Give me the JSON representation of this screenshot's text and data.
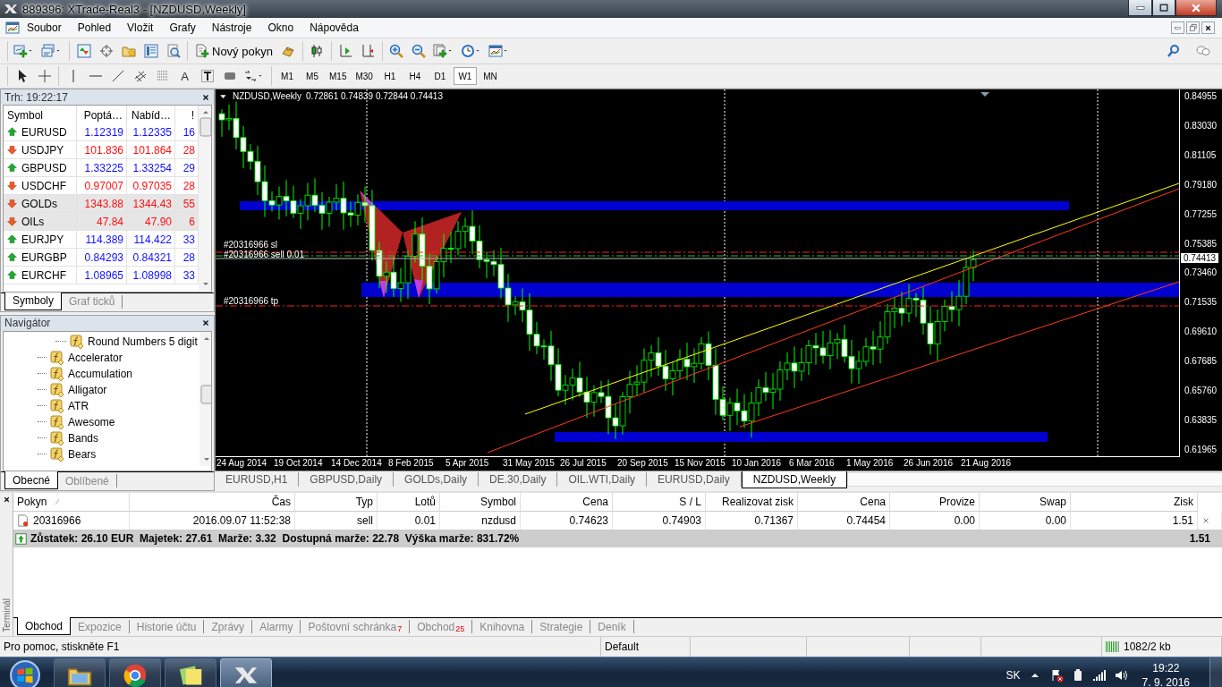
{
  "window": {
    "title": "889396: XTrade-Real3 - [NZDUSD,Weekly]"
  },
  "menu": [
    "Soubor",
    "Pohled",
    "Vložit",
    "Grafy",
    "Nástroje",
    "Okno",
    "Nápověda"
  ],
  "toolbar": {
    "new_order": "Nový pokyn",
    "text_tool": "A"
  },
  "timeframes": [
    {
      "label": "M1",
      "selected": false
    },
    {
      "label": "M5",
      "selected": false
    },
    {
      "label": "M15",
      "selected": false
    },
    {
      "label": "M30",
      "selected": false
    },
    {
      "label": "H1",
      "selected": false
    },
    {
      "label": "H4",
      "selected": false
    },
    {
      "label": "D1",
      "selected": false
    },
    {
      "label": "W1",
      "selected": true
    },
    {
      "label": "MN",
      "selected": false
    }
  ],
  "market_watch": {
    "title": "Trh: 19:22:17",
    "columns": [
      "Symbol",
      "Poptá…",
      "Nabíd…",
      "!"
    ],
    "rows": [
      {
        "symbol": "EURUSD",
        "bid": "1.12319",
        "ask": "1.12335",
        "spread": "16",
        "rising": true,
        "highlighted": false
      },
      {
        "symbol": "USDJPY",
        "bid": "101.836",
        "ask": "101.864",
        "spread": "28",
        "rising": false,
        "highlighted": false
      },
      {
        "symbol": "GBPUSD",
        "bid": "1.33225",
        "ask": "1.33254",
        "spread": "29",
        "rising": true,
        "highlighted": false
      },
      {
        "symbol": "USDCHF",
        "bid": "0.97007",
        "ask": "0.97035",
        "spread": "28",
        "rising": false,
        "highlighted": false
      },
      {
        "symbol": "GOLDs",
        "bid": "1343.88",
        "ask": "1344.43",
        "spread": "55",
        "rising": false,
        "highlighted": true
      },
      {
        "symbol": "OILs",
        "bid": "47.84",
        "ask": "47.90",
        "spread": "6",
        "rising": false,
        "highlighted": true
      },
      {
        "symbol": "EURJPY",
        "bid": "114.389",
        "ask": "114.422",
        "spread": "33",
        "rising": true,
        "highlighted": false
      },
      {
        "symbol": "EURGBP",
        "bid": "0.84293",
        "ask": "0.84321",
        "spread": "28",
        "rising": true,
        "highlighted": false
      },
      {
        "symbol": "EURCHF",
        "bid": "1.08965",
        "ask": "1.08998",
        "spread": "33",
        "rising": true,
        "highlighted": false
      }
    ],
    "tabs": [
      {
        "label": "Symboly",
        "selected": true
      },
      {
        "label": "Graf ticků",
        "selected": false
      }
    ]
  },
  "navigator": {
    "title": "Navigátor",
    "items": [
      {
        "children": [
          {
            "label": "Round Numbers 5 digit"
          }
        ]
      },
      {
        "label": "Accelerator"
      },
      {
        "label": "Accumulation"
      },
      {
        "label": "Alligator"
      },
      {
        "label": "ATR"
      },
      {
        "label": "Awesome"
      },
      {
        "label": "Bands"
      },
      {
        "label": "Bears"
      }
    ],
    "tabs": [
      {
        "label": "Obecné",
        "selected": true
      },
      {
        "label": "Oblíbené",
        "selected": false
      }
    ]
  },
  "chart": {
    "symbol": "NZDUSD,Weekly",
    "ohlc": "0.72861 0.74839 0.72844 0.74413",
    "price_ticks": [
      "0.84955",
      "0.83030",
      "0.81105",
      "0.79180",
      "0.77255",
      "0.75385",
      "0.73460",
      "0.71535",
      "0.69610",
      "0.67685",
      "0.65760",
      "0.63835",
      "0.61965"
    ],
    "current_price": "0.74413",
    "date_ticks": [
      "24 Aug 2014",
      "19 Oct 2014",
      "14 Dec 2014",
      "8 Feb 2015",
      "5 Apr 2015",
      "31 May 2015",
      "26 Jul 2015",
      "20 Sep 2015",
      "15 Nov 2015",
      "10 Jan 2016",
      "6 Mar 2016",
      "1 May 2016",
      "26 Jun 2016",
      "21 Aug 2016"
    ],
    "order_labels": [
      {
        "text": "#20316966 sl",
        "kind": "sl"
      },
      {
        "text": "#20316966 sell 0.01",
        "kind": "open"
      },
      {
        "text": "#20316966 tp",
        "kind": "tp"
      }
    ]
  },
  "chart_tabs": [
    {
      "label": "EURUSD,H1",
      "selected": false
    },
    {
      "label": "GBPUSD,Daily",
      "selected": false
    },
    {
      "label": "GOLDs,Daily",
      "selected": false
    },
    {
      "label": "DE.30,Daily",
      "selected": false
    },
    {
      "label": "OIL.WTI,Daily",
      "selected": false
    },
    {
      "label": "EURUSD,Daily",
      "selected": false
    },
    {
      "label": "NZDUSD,Weekly",
      "selected": true
    }
  ],
  "terminal": {
    "side_label": "Terminál",
    "columns": [
      "Pokyn",
      "Čas",
      "Typ",
      "Lotů",
      "Symbol",
      "Cena",
      "S / L",
      "Realizovat zisk",
      "Cena",
      "Provize",
      "Swap",
      "Zisk"
    ],
    "orders": [
      {
        "cells": [
          "20316966",
          "2016.09.07 11:52:38",
          "sell",
          "0.01",
          "nzdusd",
          "0.74623",
          "0.74903",
          "0.71367",
          "0.74454",
          "0.00",
          "0.00",
          "1.51"
        ]
      }
    ],
    "summary": {
      "text": "Zůstatek: 26.10 EUR  Majetek: 27.61  Marže: 3.32  Dostupná marže: 22.78  Výška marže: 831.72%",
      "total": "1.51"
    },
    "tabs": [
      {
        "label": "Obchod",
        "selected": true
      },
      {
        "label": "Expozice",
        "selected": false
      },
      {
        "label": "Historie účtu",
        "selected": false
      },
      {
        "label": "Zprávy",
        "selected": false
      },
      {
        "label": "Alarmy",
        "selected": false
      },
      {
        "label": "Poštovní schránka",
        "badge": "7",
        "selected": false
      },
      {
        "label": "Obchod",
        "badge": "25",
        "selected": false
      },
      {
        "label": "Knihovna",
        "selected": false
      },
      {
        "label": "Strategie",
        "selected": false
      },
      {
        "label": "Deník",
        "selected": false
      }
    ]
  },
  "status_bar": {
    "help": "Pro pomoc, stiskněte F1",
    "profile": "Default",
    "traffic": "1082/2 kb"
  },
  "taskbar": {
    "language": "SK",
    "time": "19:22",
    "date": "7. 9. 2016"
  }
}
